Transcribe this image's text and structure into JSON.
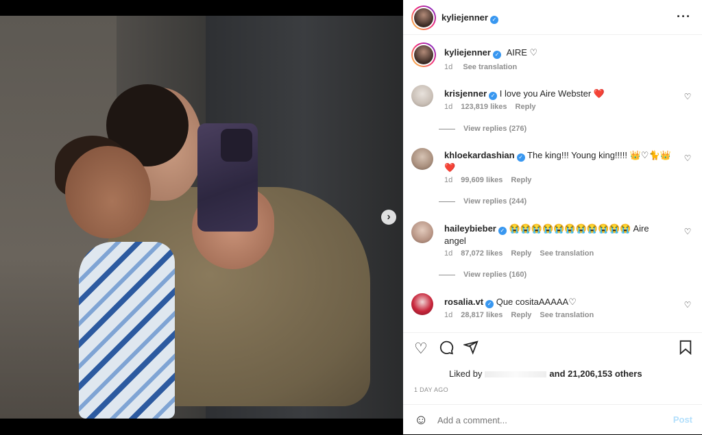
{
  "post": {
    "username": "kyliejenner",
    "caption_text": "AIRE ♡",
    "caption_time": "1d",
    "caption_translate": "See translation",
    "more_icon": "more-horizontal-icon",
    "image_description_icon": "photo"
  },
  "comments": [
    {
      "user": "krisjenner",
      "text": "I love you Aire Webster ❤️",
      "time": "1d",
      "likes": "123,819 likes",
      "reply": "Reply",
      "translate": "",
      "view_replies": "View replies (276)"
    },
    {
      "user": "khloekardashian",
      "text": "The king!!! Young king!!!!! 👑♡🐈👑 ❤️",
      "time": "1d",
      "likes": "99,609 likes",
      "reply": "Reply",
      "translate": "",
      "view_replies": "View replies (244)"
    },
    {
      "user": "haileybieber",
      "text": "😭😭😭😭😭😭😭😭😭😭😭 Aire angel",
      "time": "1d",
      "likes": "87,072 likes",
      "reply": "Reply",
      "translate": "See translation",
      "view_replies": "View replies (160)"
    },
    {
      "user": "rosalia.vt",
      "text": "Que cositaAAAAA♡",
      "time": "1d",
      "likes": "28,817 likes",
      "reply": "Reply",
      "translate": "See translation",
      "view_replies": ""
    }
  ],
  "likes_summary": {
    "prefix": "Liked by",
    "suffix": "and 21,206,153 others",
    "time_ago": "1 DAY AGO"
  },
  "comment_box": {
    "placeholder": "Add a comment...",
    "post_label": "Post"
  },
  "carousel": {
    "slide_count": 5,
    "active_index": 0
  },
  "colors": {
    "verified": "#3897f0",
    "post_disabled": "#b2dffc",
    "muted": "#8e8e8e"
  }
}
